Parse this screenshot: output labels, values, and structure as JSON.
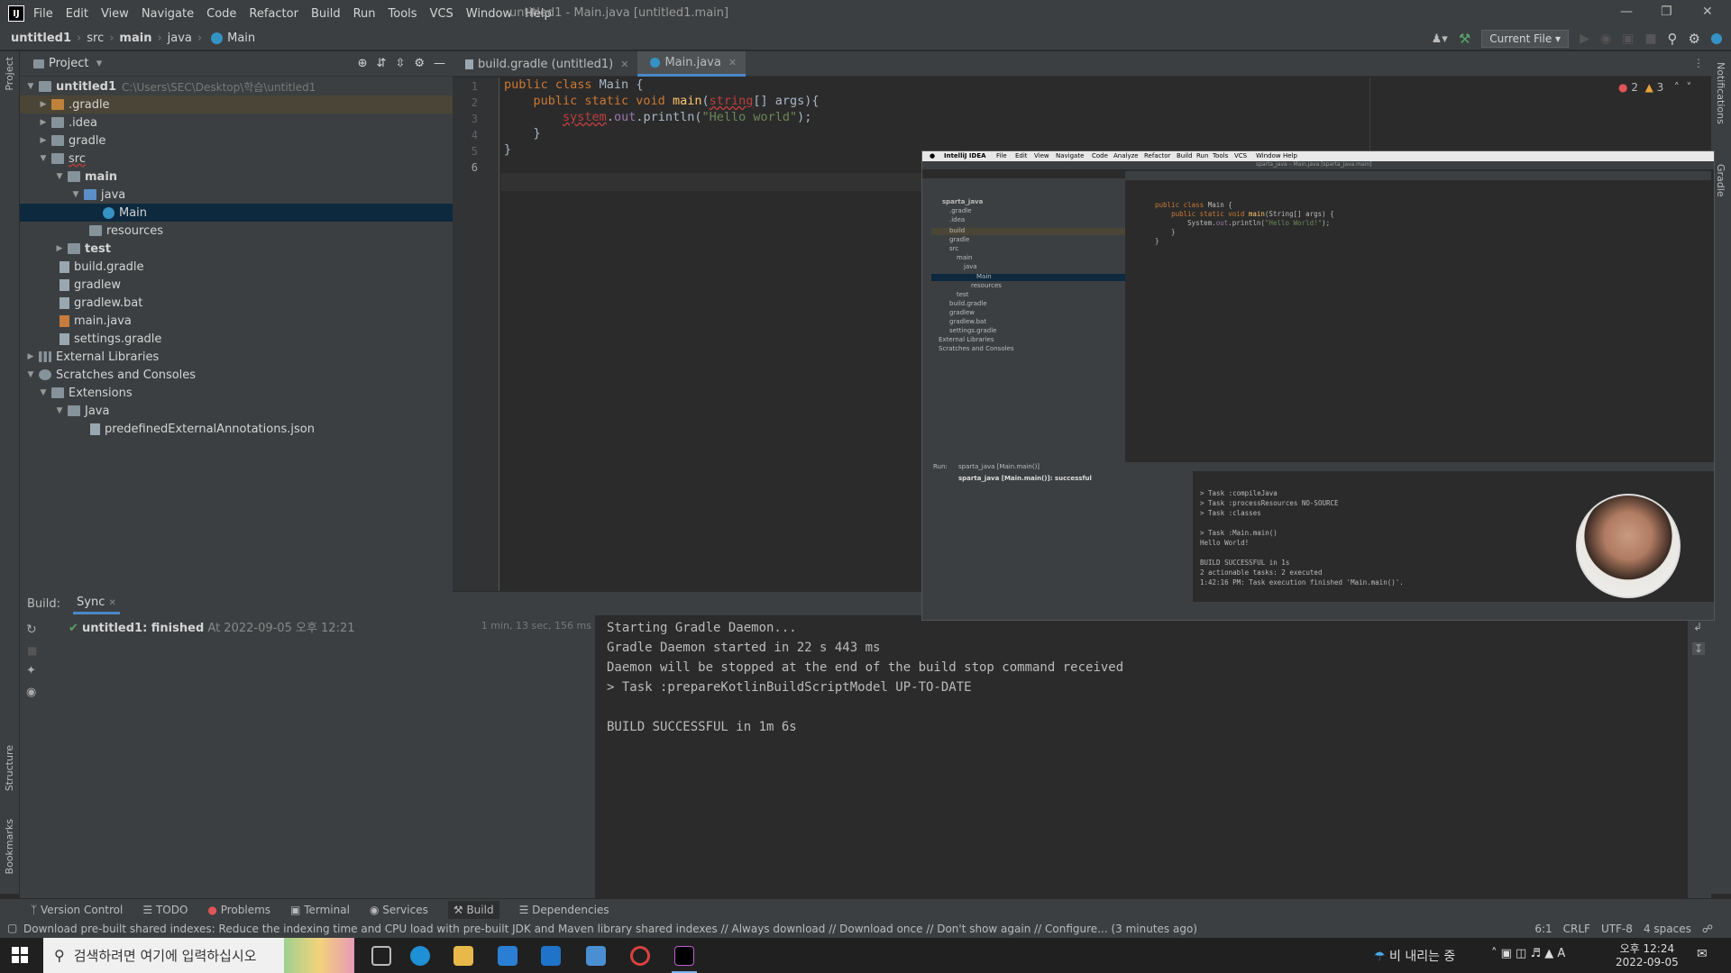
{
  "titlebar": {
    "menu": [
      "File",
      "Edit",
      "View",
      "Navigate",
      "Code",
      "Refactor",
      "Build",
      "Run",
      "Tools",
      "VCS",
      "Window",
      "Help"
    ],
    "title": "untitled1 - Main.java [untitled1.main]"
  },
  "navbar": {
    "crumbs": [
      "untitled1",
      "src",
      "main",
      "java",
      "Main"
    ],
    "run_config": "Current File"
  },
  "project": {
    "header": "Project",
    "tree": [
      {
        "label": "untitled1",
        "hint": "C:\\Users\\SEC\\Desktop\\학습\\untitled1"
      },
      {
        "label": ".gradle"
      },
      {
        "label": ".idea"
      },
      {
        "label": "gradle"
      },
      {
        "label": "src"
      },
      {
        "label": "main"
      },
      {
        "label": "java"
      },
      {
        "label": "Main"
      },
      {
        "label": "resources"
      },
      {
        "label": "test"
      },
      {
        "label": "build.gradle"
      },
      {
        "label": "gradlew"
      },
      {
        "label": "gradlew.bat"
      },
      {
        "label": "main.java"
      },
      {
        "label": "settings.gradle"
      },
      {
        "label": "External Libraries"
      },
      {
        "label": "Scratches and Consoles"
      },
      {
        "label": "Extensions"
      },
      {
        "label": "Java"
      },
      {
        "label": "predefinedExternalAnnotations.json"
      }
    ]
  },
  "tabs": [
    {
      "label": "build.gradle (untitled1)"
    },
    {
      "label": "Main.java"
    }
  ],
  "editor": {
    "line_numbers": [
      "1",
      "2",
      "3",
      "4",
      "5",
      "6"
    ],
    "inspections": {
      "errors": "2",
      "warnings": "3"
    }
  },
  "build": {
    "header_label": "Build:",
    "tab": "Sync",
    "status": "untitled1: finished",
    "status_time": "At 2022-09-05 오후 12:21",
    "duration": "1 min, 13 sec, 156 ms",
    "console": [
      "Starting Gradle Daemon...",
      "Gradle Daemon started in 22 s 443 ms",
      "Daemon will be stopped at the end of the build stop command received",
      "> Task :prepareKotlinBuildScriptModel UP-TO-DATE",
      "",
      "BUILD SUCCESSFUL in 1m 6s"
    ]
  },
  "side_tabs": {
    "project": "Project",
    "structure": "Structure",
    "bookmarks": "Bookmarks",
    "notifications": "Notifications",
    "gradle": "Gradle"
  },
  "bottom_tabs": [
    "Version Control",
    "TODO",
    "Problems",
    "Terminal",
    "Services",
    "Build",
    "Dependencies"
  ],
  "statusbar": {
    "message": "Download pre-built shared indexes: Reduce the indexing time and CPU load with pre-built JDK and Maven library shared indexes // Always download // Download once // Don't show again // Configure... (3 minutes ago)",
    "position": "6:1",
    "line_sep": "CRLF",
    "encoding": "UTF-8",
    "indent": "4 spaces"
  },
  "taskbar": {
    "search_placeholder": "검색하려면 여기에 입력하십시오",
    "weather": "비 내리는 중",
    "time": "오후 12:24",
    "date": "2022-09-05"
  },
  "overlay": {
    "menu": [
      "IntelliJ IDEA",
      "File",
      "Edit",
      "View",
      "Navigate",
      "Code",
      "Analyze",
      "Refactor",
      "Build",
      "Run",
      "Tools",
      "VCS",
      "Window",
      "Help"
    ],
    "title": "sparta_java – Main.java [sparta_java.main]",
    "tree": [
      "sparta_java",
      ".gradle",
      ".idea",
      "build",
      "gradle",
      "src",
      "main",
      "java",
      "Main",
      "resources",
      "test",
      "build.gradle",
      "gradlew",
      "gradlew.bat",
      "settings.gradle",
      "External Libraries",
      "Scratches and Consoles"
    ],
    "code": [
      "public class Main {",
      "    public static void main(String[] args) {",
      "        System.out.println(\"Hello World!\");",
      "    }",
      "}"
    ],
    "run_label": "Run:",
    "run_tab": "sparta_java [Main.main()]",
    "run_status": "sparta_java [Main.main()]: successful",
    "console": [
      "> Task :compileJava",
      "> Task :processResources NO-SOURCE",
      "> Task :classes",
      "",
      "> Task :Main.main()",
      "Hello World!",
      "",
      "BUILD SUCCESSFUL in 1s",
      "2 actionable tasks: 2 executed",
      "1:42:16 PM: Task execution finished 'Main.main()'."
    ]
  },
  "colors": {
    "accent": "#4a88c7",
    "selection": "#0d293e",
    "keyword": "#cc7832",
    "string": "#6a8759",
    "error": "#bc3f3c"
  }
}
